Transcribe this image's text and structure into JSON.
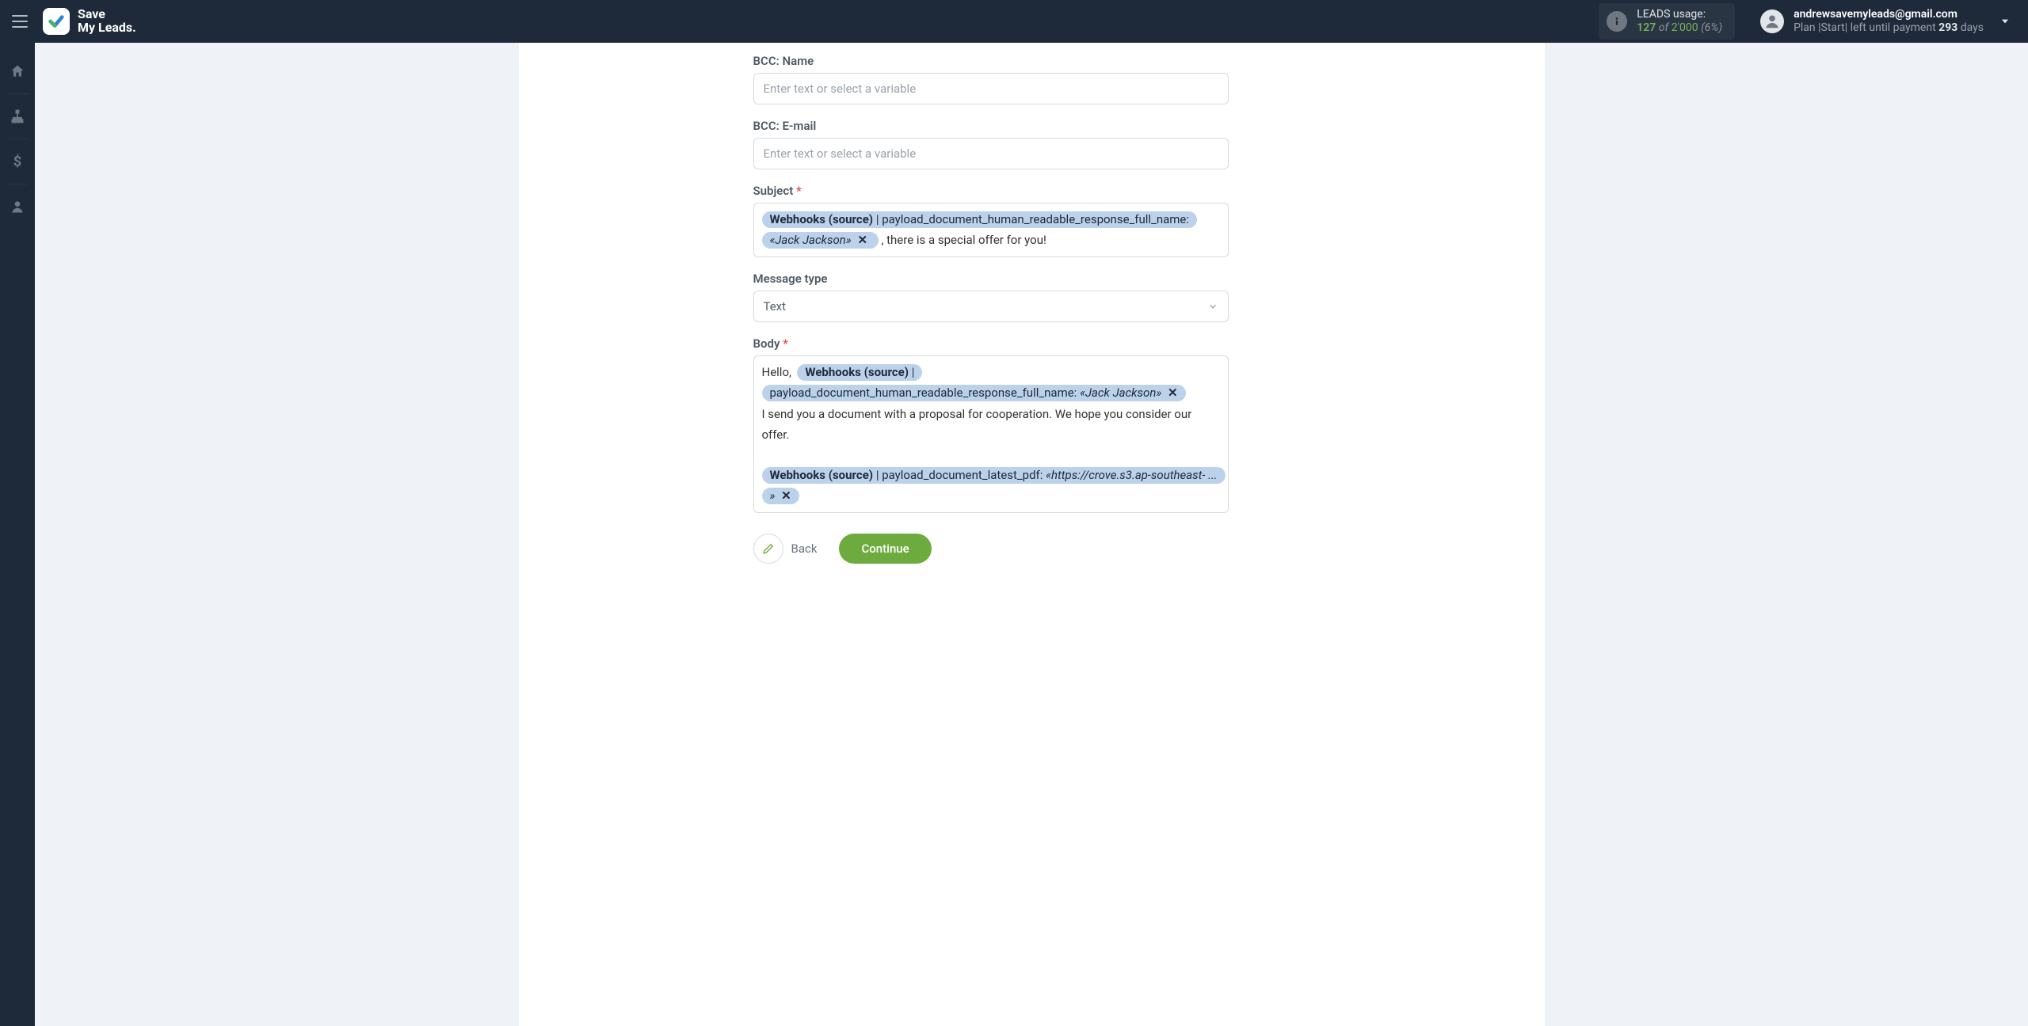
{
  "brand": {
    "line1": "Save",
    "line2": "My Leads."
  },
  "usage": {
    "label": "LEADS usage:",
    "used": "127",
    "of_word": "of",
    "total": "2'000",
    "pct": "(6%)"
  },
  "account": {
    "email": "andrewsavemyleads@gmail.com",
    "plan_prefix": "Plan |Start| left until payment ",
    "days_number": "293",
    "days_suffix": " days"
  },
  "sidebar_icons": [
    "home",
    "sitemap",
    "dollar",
    "user"
  ],
  "form": {
    "bcc_name": {
      "label": "BCC: Name",
      "placeholder": "Enter text or select a variable"
    },
    "bcc_email": {
      "label": "BCC: E-mail",
      "placeholder": "Enter text or select a variable"
    },
    "subject": {
      "label": "Subject",
      "pill_source": "Webhooks (source)",
      "pill_field": "payload_document_human_readable_response_full_name:",
      "pill_value": "«Jack Jackson»",
      "text_after": " , there is a special offer for you!"
    },
    "message_type": {
      "label": "Message type",
      "value": "Text"
    },
    "body": {
      "label": "Body",
      "hello": "Hello, ",
      "pill1_source": "Webhooks (source)",
      "pill1_field": "payload_document_human_readable_response_full_name:",
      "pill1_value": "«Jack Jackson»",
      "line2": "I send you a document with a proposal for cooperation. We hope you consider our offer.",
      "pill2_source": "Webhooks (source)",
      "pill2_field": "payload_document_latest_pdf:",
      "pill2_value": "«https://crove.s3.ap-southeast- ... »"
    }
  },
  "buttons": {
    "back": "Back",
    "continue": "Continue"
  }
}
